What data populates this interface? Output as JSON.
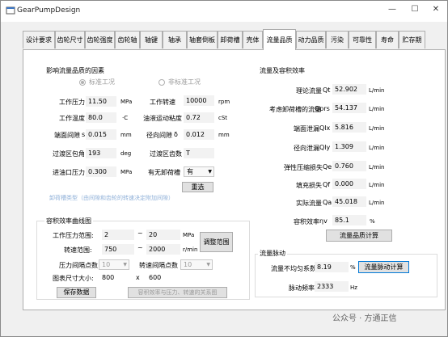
{
  "window": {
    "title": "GearPumpDesign",
    "min": "—",
    "max": "☐",
    "close": "✕"
  },
  "tabs": [
    "设计要求",
    "齿轮尺寸",
    "齿轮强度",
    "齿轮轴",
    "轴键",
    "轴承",
    "轴套倒板",
    "卸荷槽",
    "壳体",
    "流量品质",
    "动力品质",
    "污染",
    "可靠性",
    "寿命",
    "贮存期"
  ],
  "active_tab": "流量品质",
  "factors": {
    "title": "影响流量品质的因素",
    "radio_standard": "标准工况",
    "radio_nonstandard": "非标准工况",
    "work_pressure_label": "工作压力",
    "work_pressure": "11.50",
    "work_pressure_unit": "MPa",
    "work_speed_label": "工作转速",
    "work_speed": "10000",
    "work_speed_unit": "rpm",
    "work_temp_label": "工作温度",
    "work_temp": "80.0",
    "work_temp_unit": "·C",
    "viscosity_label": "油液运动粘度",
    "viscosity": "0.72",
    "viscosity_unit": "cSt",
    "end_gap_label": "端面间隙",
    "end_gap_sym": "s",
    "end_gap": "0.015",
    "end_gap_unit": "mm",
    "radial_gap_label": "径向间隙",
    "radial_gap_sym": "δ",
    "radial_gap": "0.012",
    "radial_gap_unit": "mm",
    "trans_angle_label": "过渡区包角",
    "trans_angle": "193",
    "trans_angle_unit": "deg",
    "trans_teeth_label": "过渡区齿数",
    "trans_teeth": "T",
    "inlet_pressure_label": "进油口压力",
    "inlet_pressure": "0.300",
    "inlet_pressure_unit": "MPa",
    "unload_label": "有无卸荷槽",
    "unload_value": "有",
    "hint": "卸荷槽类型（由间隙和齿轮的转速决定附加间隙）",
    "reset_button": "重选"
  },
  "curve": {
    "title": "容积效率曲线图",
    "pressure_range_label": "工作压力范围:",
    "pressure_min": "2",
    "pressure_max": "20",
    "pressure_unit": "MPa",
    "speed_range_label": "转速范围:",
    "speed_min": "750",
    "speed_max": "2000",
    "speed_unit": "r/min",
    "tilde": "~",
    "adjust_button": "调整范围",
    "pressure_points_label": "压力间隔点数",
    "pressure_points": "10",
    "speed_points_label": "转速间隔点数",
    "speed_points": "10",
    "size_label": "图表尺寸大小:",
    "width": "800",
    "x": "x",
    "height": "600",
    "save_button": "保存数据",
    "relation_button": "容积效率与压力、转速的关系图"
  },
  "flow": {
    "title": "流量及容积效率",
    "rows": [
      {
        "label": "理论流量",
        "sym": "Qt",
        "value": "52.902",
        "unit": "L/min"
      },
      {
        "label": "考虑卸荷槽的流量",
        "sym": "Qprs",
        "value": "54.137",
        "unit": "L/min"
      },
      {
        "label": "端面泄漏",
        "sym": "Qlx",
        "value": "5.816",
        "unit": "L/min"
      },
      {
        "label": "径向泄漏",
        "sym": "Qly",
        "value": "1.309",
        "unit": "L/min"
      },
      {
        "label": "弹性压缩损失",
        "sym": "Qe",
        "value": "0.760",
        "unit": "L/min"
      },
      {
        "label": "填充损失",
        "sym": "Qf",
        "value": "0.000",
        "unit": "L/min"
      },
      {
        "label": "实际流量",
        "sym": "Qa",
        "value": "45.018",
        "unit": "L/min"
      },
      {
        "label": "容积效率",
        "sym": "ηv",
        "value": "85.1",
        "unit": "%"
      }
    ],
    "calc_button": "流量品质计算"
  },
  "pulse": {
    "title": "流量脉动",
    "nonuniform_label": "流量不均匀系数",
    "nonuniform": "8.19",
    "nonuniform_unit": "%",
    "calc_button": "流量脉动计算",
    "freq_label": "脉动频率",
    "freq": "2333",
    "freq_unit": "Hz"
  },
  "watermark": "公众号 · 方通正信"
}
